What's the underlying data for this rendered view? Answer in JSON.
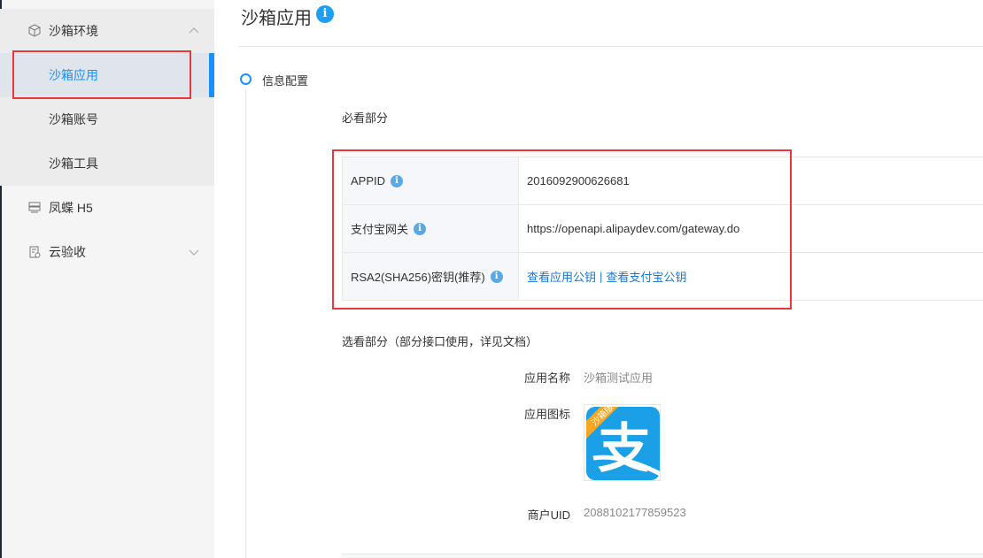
{
  "sidebar": {
    "group_title": "沙箱环境",
    "items": [
      {
        "label": "沙箱应用"
      },
      {
        "label": "沙箱账号"
      },
      {
        "label": "沙箱工具"
      }
    ],
    "fengdie": "凤蝶 H5",
    "yunyanshou": "云验收"
  },
  "header": {
    "title": "沙箱应用",
    "info_glyph": "i"
  },
  "timeline": {
    "step_label": "信息配置"
  },
  "required": {
    "title": "必看部分",
    "rows": [
      {
        "key": "APPID",
        "value": "2016092900626681"
      },
      {
        "key": "支付宝网关",
        "value": "https://openapi.alipaydev.com/gateway.do"
      },
      {
        "key": "RSA2(SHA256)密钥(推荐)",
        "link1": "查看应用公钥",
        "sep": "|",
        "link2": "查看支付宝公钥"
      }
    ]
  },
  "optional": {
    "title": "选看部分（部分接口使用，详见文档）",
    "app_name_label": "应用名称",
    "app_name": "沙箱测试应用",
    "app_icon_label": "应用图标",
    "app_icon_ribbon": "沙箱版",
    "app_icon_glyph": "支",
    "merchant_uid_label": "商户UID",
    "merchant_uid": "2088102177859523"
  },
  "colors": {
    "accent": "#1890ff",
    "alipay_blue": "#1ba0e8",
    "ribbon": "#f5a623",
    "highlight_red": "#e8373a"
  }
}
